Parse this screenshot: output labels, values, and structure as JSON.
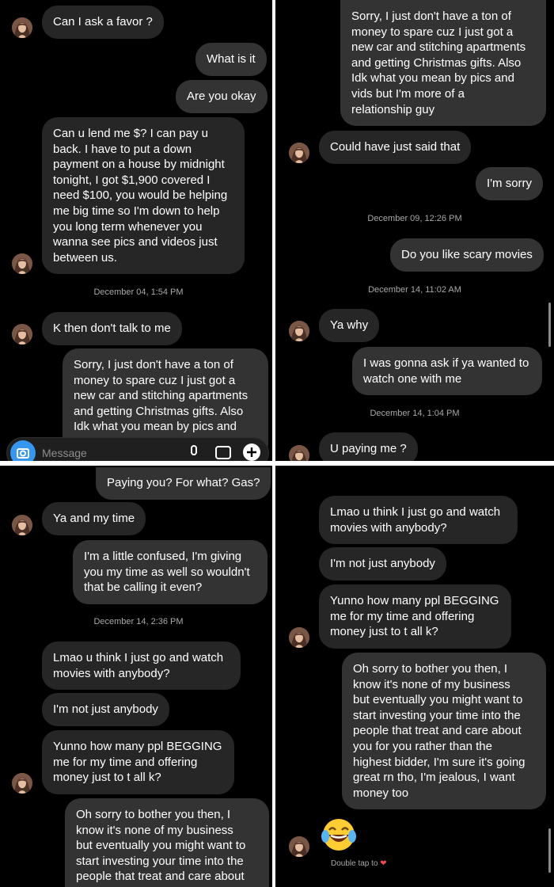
{
  "panel1": {
    "messages": [
      "Can I ask a favor ?",
      "What is it",
      "Are you okay",
      "Can u lend me  $? I can pay u\nback. I have to put a down\npayment on a house by midnight\ntonight, I got $1,900 covered I\nneed $100, you would be helping\nme big time so I'm down to help\nyou long term whenever you\nwanna see pics and videos just\nbetween us.",
      "K then don't talk to me",
      "Sorry, I just don't have a ton of\nmoney to spare cuz I just got a\nnew car and stitching apartments\nand getting Christmas gifts. Also\nIdk what you mean by pics and"
    ],
    "timestamp": "December 04, 1:54 PM",
    "composer_placeholder": "Message"
  },
  "panel2": {
    "messages": [
      "Sorry, I just don't have a ton of\nmoney to spare cuz I just got a\nnew car and stitching apartments\nand getting Christmas gifts. Also\nIdk what you mean by pics and\nvids but I'm more of a\nrelationship guy",
      "Could have just said that",
      "I'm sorry",
      "Do you like scary movies",
      "Ya why",
      "I was gonna ask if ya wanted to\nwatch one with me",
      "U paying me ?"
    ],
    "timestamps": [
      "December 09, 12:26 PM",
      "December 14, 11:02 AM",
      "December 14, 1:04 PM"
    ]
  },
  "panel3": {
    "messages": [
      "Paying you? For what? Gas?",
      "Ya and my time",
      "I'm a little confused, I'm giving\nyou my time as well so wouldn't\nthat be calling it even?",
      "Lmao u think I just go and watch\nmovies with anybody?",
      "I'm not just anybody",
      "Yunno how many ppl BEGGING\nme for my time and offering\nmoney just to t all k?",
      "Oh sorry to bother you then, I\nknow it's none of my business\nbut eventually you might want to\nstart investing your time into the\npeople that treat and care about"
    ],
    "timestamp": "December 14, 2:36 PM"
  },
  "panel4": {
    "messages": [
      "Lmao u think I just go and watch\nmovies with anybody?",
      "I'm not just anybody",
      "Yunno how many ppl BEGGING\nme for my time and offering\nmoney just to t all k?",
      "Oh sorry to bother you then, I\nknow it's none of my business\nbut eventually you might want to\nstart investing your time into the\npeople that treat and care about\nyou for you rather than the\nhighest bidder, I'm sure it's going\ngreat rn tho, I'm jealous, I want\nmoney too"
    ],
    "emoji": "😂",
    "double_tap_text": "Double tap to",
    "heart": "❤"
  },
  "colors": {
    "background": "#000000",
    "incoming_bubble": "#262626",
    "outgoing_bubble": "#333333",
    "accent": "#3797f0",
    "heart": "#ed4956"
  },
  "icons": [
    "avatar",
    "camera-icon",
    "microphone-icon",
    "image-icon",
    "plus-icon",
    "heart-icon"
  ]
}
